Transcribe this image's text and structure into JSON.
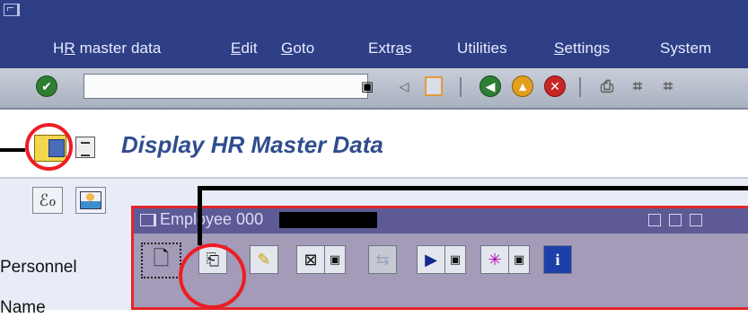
{
  "menu": {
    "items": [
      {
        "label": "HR master data"
      },
      {
        "label": "Edit"
      },
      {
        "label": "Goto"
      },
      {
        "label": "Extras"
      },
      {
        "label": "Utilities"
      },
      {
        "label": "Settings"
      },
      {
        "label": "System"
      }
    ]
  },
  "toolbar": {
    "command_field_value": "",
    "icons": [
      "enter-check-icon",
      "dropdown-icon",
      "back-arrow-icon",
      "save-icon",
      "back-icon",
      "exit-icon",
      "cancel-icon",
      "print-icon",
      "find-icon",
      "find-next-icon"
    ]
  },
  "title": {
    "text": "Display HR Master Data"
  },
  "app": {
    "personnel_label": "Personnel",
    "name_label": "Name"
  },
  "popup": {
    "title": "Employee 000",
    "buttons": [
      "create-icon",
      "display-icon",
      "change-icon",
      "overview-icon",
      "copy-icon",
      "execute-icon",
      "infotype-icon",
      "info-icon"
    ]
  },
  "colors": {
    "menu_bg": "#2e3f86",
    "title_text": "#2f4d8e",
    "popup_title_bg": "#5d5a96",
    "annotation": "#ee1d23"
  }
}
